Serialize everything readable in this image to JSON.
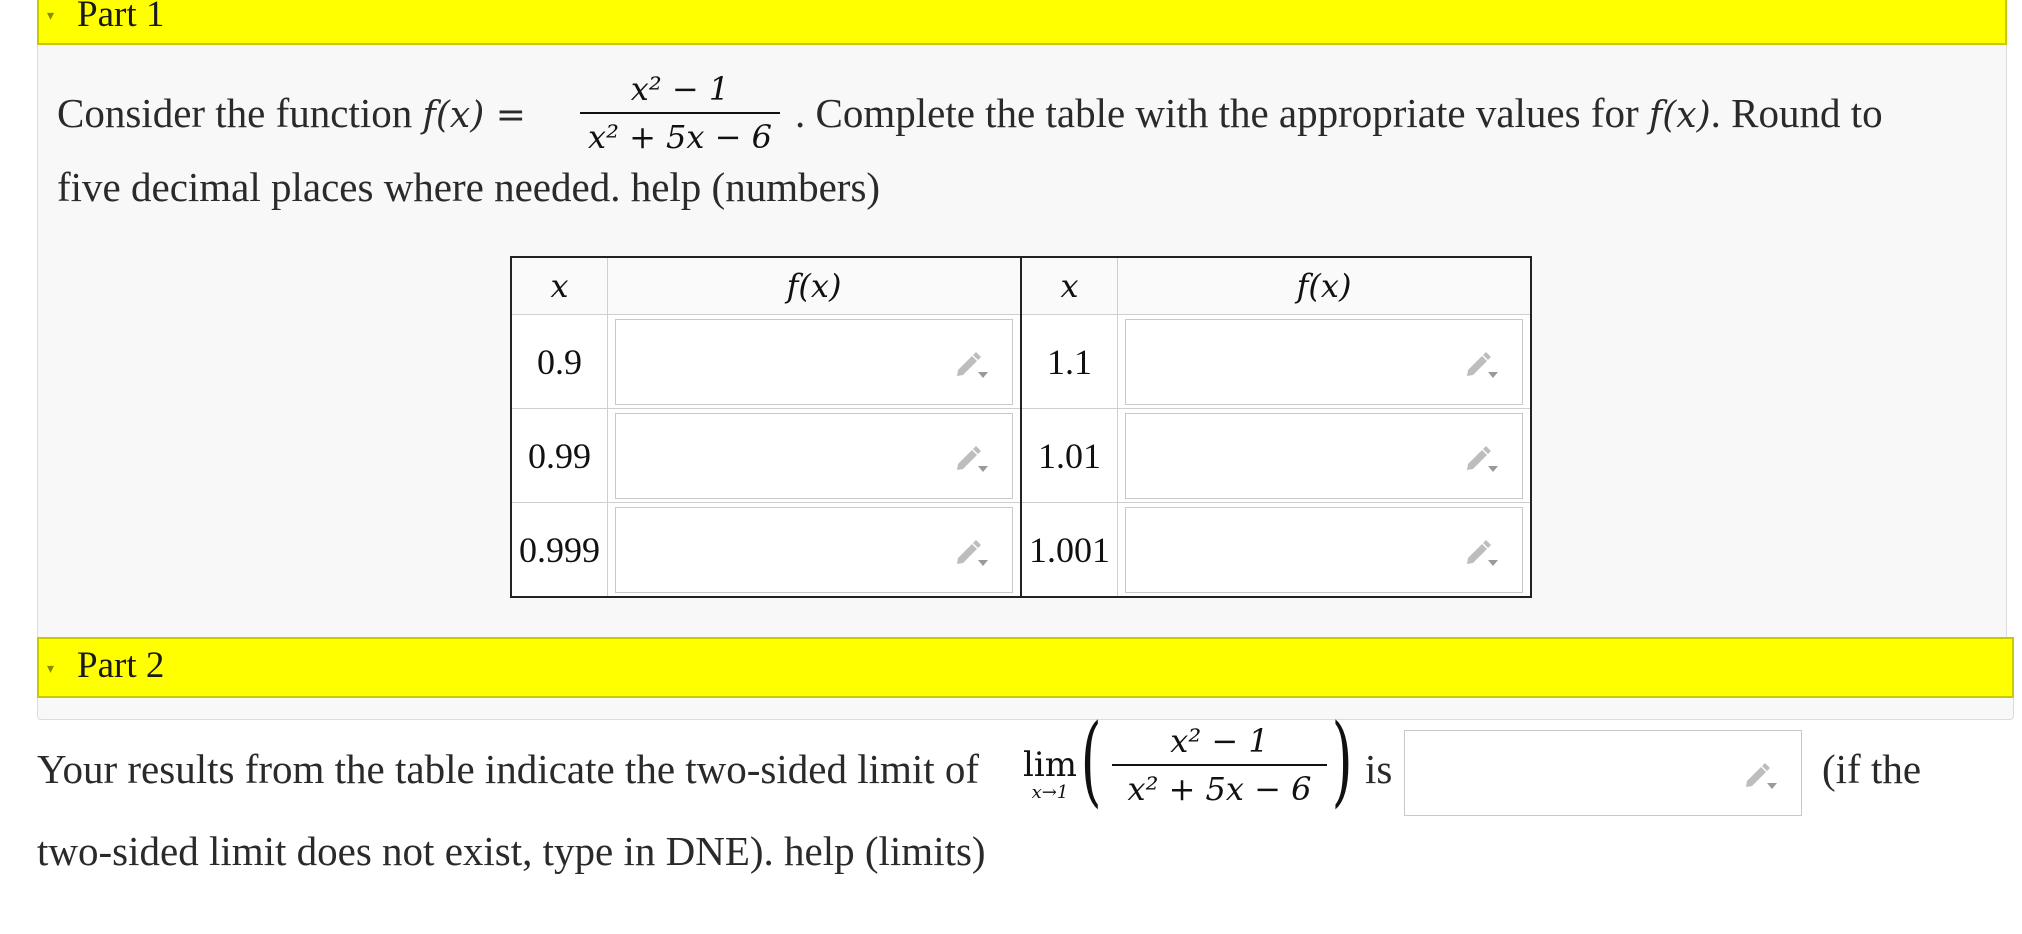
{
  "part1": {
    "title": "Part 1",
    "intro_before": "Consider the function",
    "func_name": "f(x) =",
    "fraction": {
      "num": "x² − 1",
      "den": "x² + 5x − 6"
    },
    "intro_after": ". Complete the table with the appropriate values for",
    "intro_fx": "f(x)",
    "intro_round": ". Round to",
    "line2": "five decimal places where needed.",
    "help": "help (numbers)"
  },
  "table": {
    "headers": [
      "x",
      "f(x)",
      "x",
      "f(x)"
    ],
    "rows": [
      {
        "x1": "0.9",
        "f1": "",
        "x2": "1.1",
        "f2": ""
      },
      {
        "x1": "0.99",
        "f1": "",
        "x2": "1.01",
        "f2": ""
      },
      {
        "x1": "0.999",
        "f1": "",
        "x2": "1.001",
        "f2": ""
      }
    ]
  },
  "part2": {
    "title": "Part 2",
    "text_before": "Your results from the table indicate the two-sided limit of",
    "lim": "lim",
    "lim_sub": "x→1",
    "fraction": {
      "num": "x² − 1",
      "den": "x² + 5x − 6"
    },
    "is": "is",
    "answer": "",
    "text_after": "(if the",
    "line2": "two-sided limit does not exist, type in DNE).",
    "help": "help (limits)"
  },
  "icons": {
    "answer_field": "pencil-dropdown-icon",
    "collapse": "caret-down-icon"
  },
  "colors": {
    "header_bar": "#ffff00",
    "panel": "#f8f8f8"
  }
}
